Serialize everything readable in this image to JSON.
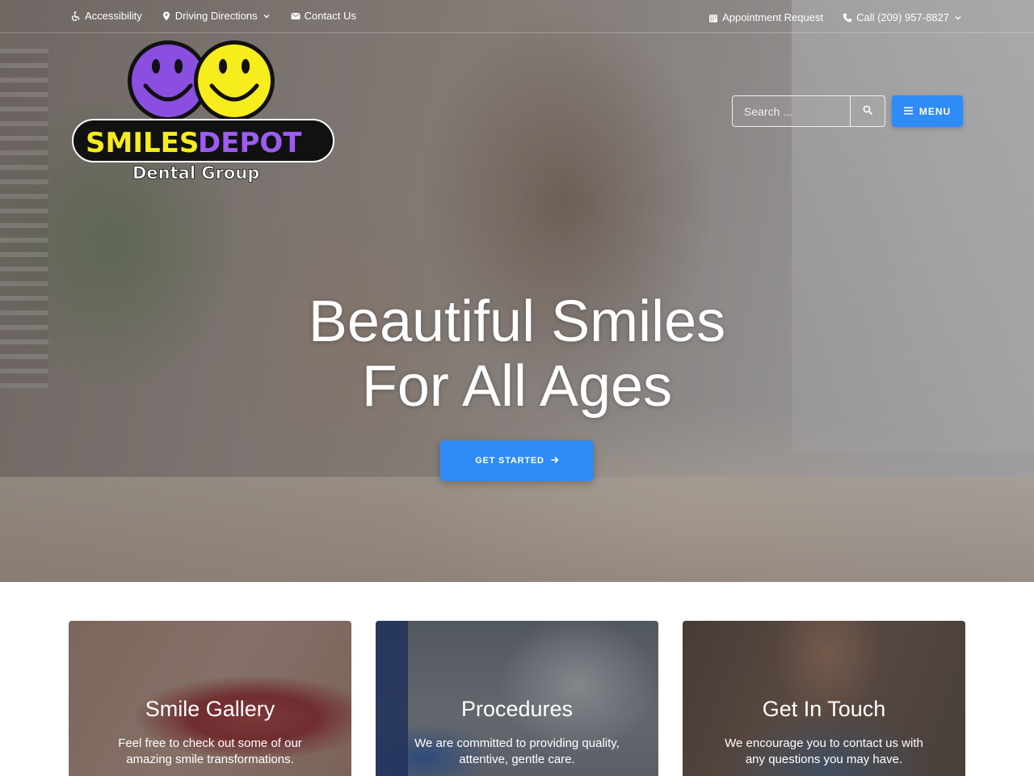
{
  "topbar": {
    "left_links": [
      {
        "label": "Accessibility",
        "icon": "wheelchair-icon"
      },
      {
        "label": "Driving Directions",
        "icon": "map-marker-icon",
        "has_dropdown": true
      },
      {
        "label": "Contact Us",
        "icon": "envelope-icon"
      }
    ],
    "right_links": [
      {
        "label": "Appointment Request",
        "icon": "calendar-icon"
      },
      {
        "label": "Call (209) 957-8827",
        "icon": "phone-icon",
        "has_dropdown": true
      }
    ]
  },
  "logo": {
    "line1": "SMILES DEPOT",
    "line2": "Dental Group",
    "colors": {
      "left_smiley": "#8a4fe0",
      "right_smiley": "#f7ec1c",
      "text_yellow": "#f7ec1c",
      "text_purple": "#9c5cf0",
      "badge": "#111111"
    }
  },
  "search": {
    "placeholder": "Search ...",
    "icon": "search-icon"
  },
  "menu": {
    "label": "MENU",
    "icon": "hamburger-icon"
  },
  "hero": {
    "headline_line1": "Beautiful Smiles",
    "headline_line2": "For All Ages",
    "cta_label": "GET STARTED",
    "cta_icon": "arrow-right-icon"
  },
  "cards": [
    {
      "title": "Smile Gallery",
      "text": "Feel free to check out some of our amazing smile transformations."
    },
    {
      "title": "Procedures",
      "text": "We are committed to providing quality, attentive, gentle care."
    },
    {
      "title": "Get In Touch",
      "text": "We encourage you to contact us with any questions you may have."
    }
  ],
  "colors": {
    "accent": "#2f8bf5",
    "white": "#ffffff"
  }
}
